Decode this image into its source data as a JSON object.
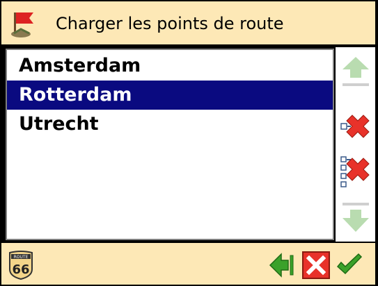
{
  "header": {
    "title": "Charger les points de route",
    "icon": "route-flag-icon"
  },
  "list": {
    "items": [
      {
        "label": "Amsterdam",
        "selected": false
      },
      {
        "label": "Rotterdam",
        "selected": true
      },
      {
        "label": "Utrecht",
        "selected": false
      }
    ]
  },
  "sidebar": {
    "buttons": [
      {
        "icon": "move-up-icon",
        "enabled": false
      },
      {
        "icon": "delete-waypoint-icon",
        "enabled": true
      },
      {
        "icon": "delete-all-waypoints-icon",
        "enabled": true
      },
      {
        "icon": "move-down-icon",
        "enabled": false
      }
    ]
  },
  "footer": {
    "logo_text": "66",
    "logo_top_text": "ROUTE",
    "buttons": [
      {
        "icon": "back-icon"
      },
      {
        "icon": "cancel-icon"
      },
      {
        "icon": "confirm-icon"
      }
    ]
  },
  "colors": {
    "header_bg": "#fde8b6",
    "selection_bg": "#0a0a80",
    "selection_text": "#ffffff",
    "accent_green": "#3aa12a",
    "cancel_red": "#e8322a"
  }
}
